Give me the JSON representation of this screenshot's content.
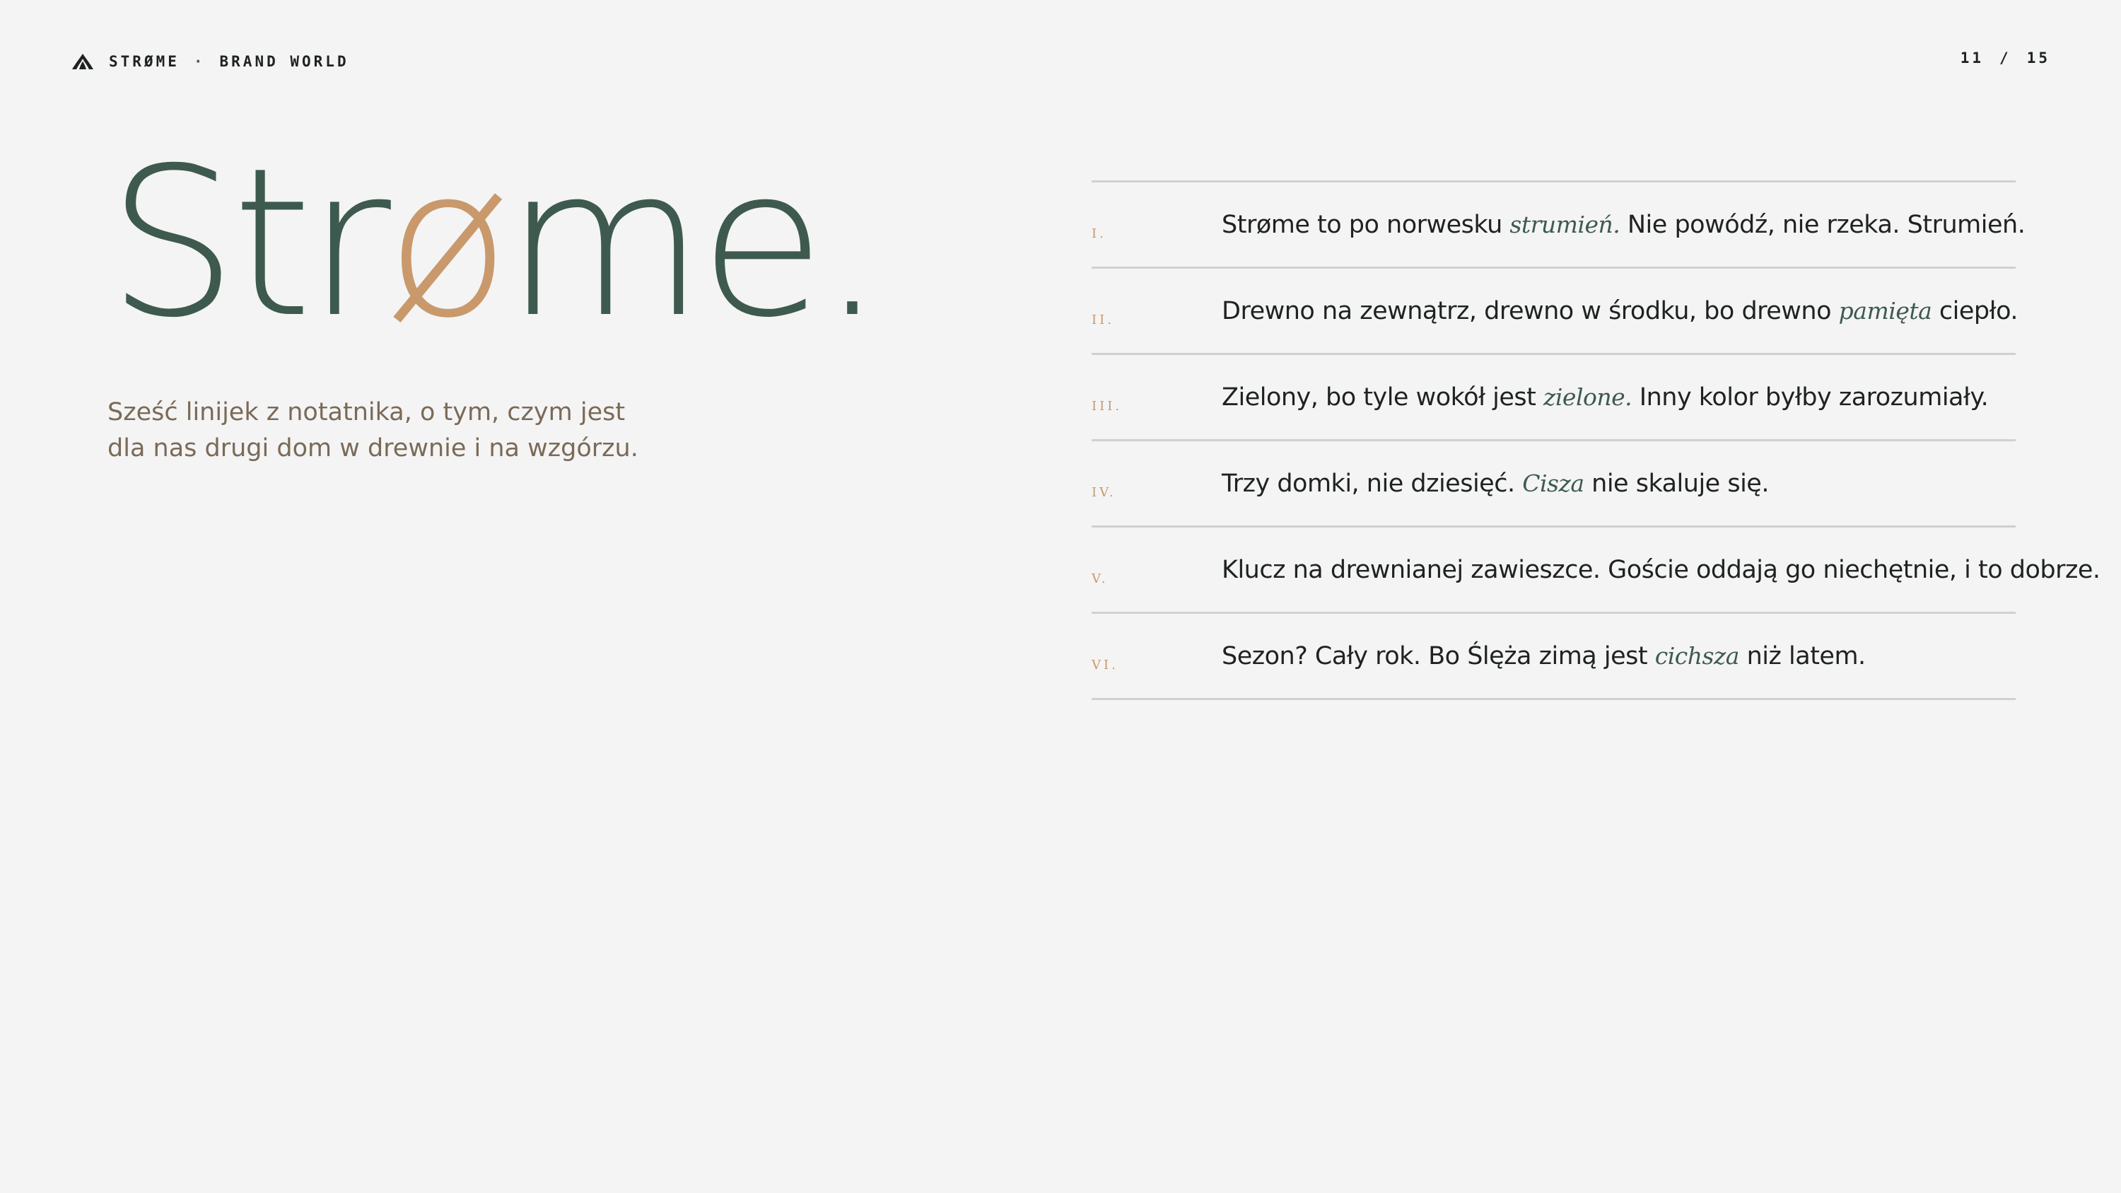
{
  "header": {
    "logo_icon": "leaf-mark-icon",
    "brand": "STRØME",
    "separator": "·",
    "section": "BRAND WORLD",
    "page_current": "11",
    "page_sep": "/",
    "page_total": "15"
  },
  "hero": {
    "wordmark_before": "Str",
    "wordmark_accent": "ø",
    "wordmark_after": "me",
    "wordmark_dot": ".",
    "subtitle": "Sześć linijek z notatnika, o tym, czym jest dla nas drugi dom w drewnie i na wzgórzu."
  },
  "notes": [
    {
      "numeral": "I.",
      "before": "Strøme to po norwesku ",
      "italic": "strumień.",
      "after": " Nie powódź, nie rzeka. Strumień."
    },
    {
      "numeral": "II.",
      "before": "Drewno na zewnątrz, drewno w środku, bo drewno ",
      "italic": "pamięta",
      "after": " ciepło."
    },
    {
      "numeral": "III.",
      "before": "Zielony, bo tyle wokół jest ",
      "italic": "zielone.",
      "after": " Inny kolor byłby zarozumiały."
    },
    {
      "numeral": "IV.",
      "before": "Trzy domki, nie dziesięć. ",
      "italic": "Cisza",
      "after": " nie skaluje się."
    },
    {
      "numeral": "V.",
      "before": "Klucz na drewnianej zawieszce. Goście oddają go niechętnie, i to dobrze.",
      "italic": "",
      "after": ""
    },
    {
      "numeral": "VI.",
      "before": "Sezon? Cały rok. Bo Ślęża zimą jest ",
      "italic": "cichsza",
      "after": " niż latem."
    }
  ],
  "colors": {
    "background": "#f4f4f4",
    "green": "#3e5a4e",
    "copper": "#c9996c",
    "subtitle": "#7a6a58",
    "rule": "#d0d0d0"
  }
}
